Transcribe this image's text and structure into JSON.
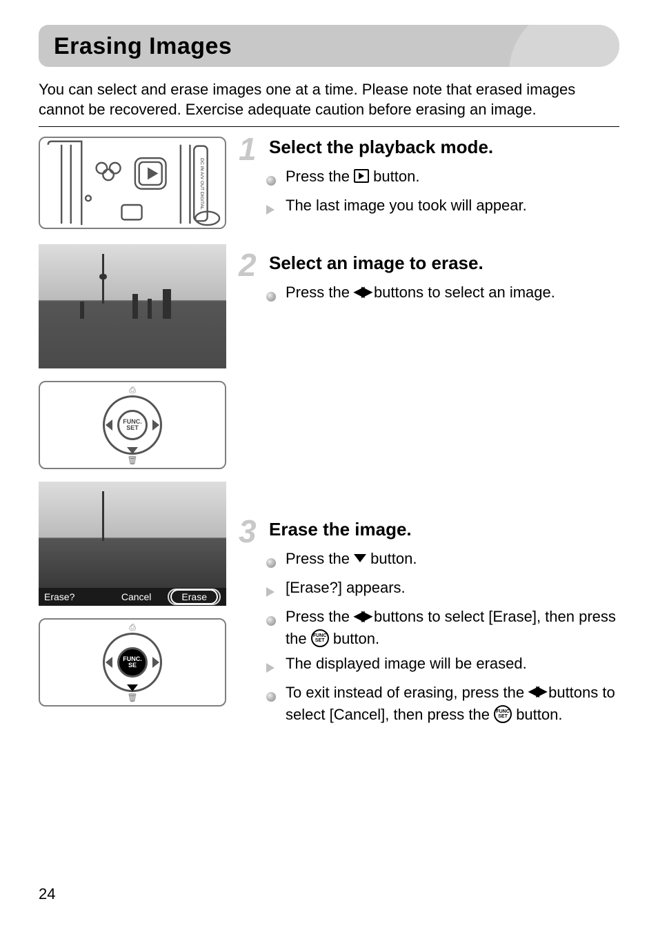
{
  "page": {
    "title": "Erasing Images",
    "intro": "You can select and erase images one at a time. Please note that erased images cannot be recovered. Exercise adequate caution before erasing an image.",
    "page_number": "24"
  },
  "steps": [
    {
      "num": "1",
      "title": "Select the playback mode.",
      "items": [
        {
          "kind": "dot",
          "pre": "Press the ",
          "icon": "play-box",
          "post": " button."
        },
        {
          "kind": "tri",
          "pre": "The last image you took will appear.",
          "icon": null,
          "post": ""
        }
      ]
    },
    {
      "num": "2",
      "title": "Select an image to erase.",
      "items": [
        {
          "kind": "dot",
          "pre": "Press the ",
          "icon": "lr",
          "post": " buttons to select an image."
        }
      ]
    },
    {
      "num": "3",
      "title": "Erase the image.",
      "items": [
        {
          "kind": "dot",
          "pre": "Press the ",
          "icon": "down",
          "post": " button."
        },
        {
          "kind": "tri",
          "pre": "[Erase?] appears.",
          "icon": null,
          "post": ""
        },
        {
          "kind": "dot",
          "pre": "Press the ",
          "icon": "lr",
          "post": " buttons to select [Erase], then press the ",
          "icon2": "func",
          "post2": " button."
        },
        {
          "kind": "tri",
          "pre": "The displayed image will be erased.",
          "icon": null,
          "post": ""
        },
        {
          "kind": "dot",
          "pre": "To exit instead of erasing, press the ",
          "icon": "lr",
          "post": " buttons to select [Cancel], then press the ",
          "icon2": "func",
          "post2": " button."
        }
      ]
    }
  ],
  "figures": {
    "fig1_port_label": "DC IN\nA/V OUT DIGITAL",
    "dial_center": "FUNC.\nSET",
    "fig4_prompt": "Erase?",
    "fig4_cancel": "Cancel",
    "fig4_erase": "Erase"
  },
  "icons": {
    "play-box": "playback-icon",
    "lr": "left-right-icon",
    "down": "down-icon",
    "func": "func-set-icon"
  }
}
